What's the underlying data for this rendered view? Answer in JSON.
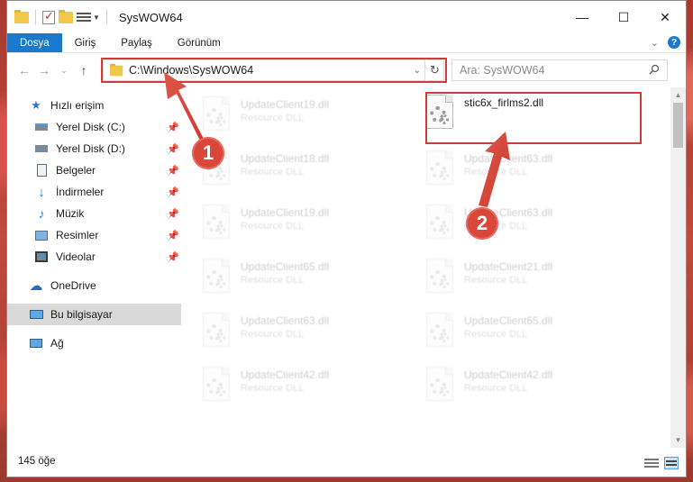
{
  "window": {
    "title": "SysWOW64",
    "controls": {
      "minimize": "—",
      "maximize": "☐",
      "close": "✕"
    }
  },
  "ribbon": {
    "tabs": [
      "Dosya",
      "Giriş",
      "Paylaş",
      "Görünüm"
    ]
  },
  "address": {
    "path": "C:\\Windows\\SysWOW64",
    "search_placeholder": "Ara: SysWOW64"
  },
  "sidebar": {
    "items": [
      {
        "label": "Hızlı erişim",
        "icon": "star-icon"
      },
      {
        "label": "Yerel Disk (C:)",
        "icon": "drive-icon",
        "pinned": true
      },
      {
        "label": "Yerel Disk (D:)",
        "icon": "drive-icon",
        "pinned": true
      },
      {
        "label": "Belgeler",
        "icon": "documents-icon",
        "pinned": true
      },
      {
        "label": "İndirmeler",
        "icon": "download-icon",
        "pinned": true
      },
      {
        "label": "Müzik",
        "icon": "music-icon",
        "pinned": true
      },
      {
        "label": "Resimler",
        "icon": "pictures-icon",
        "pinned": true
      },
      {
        "label": "Videolar",
        "icon": "videos-icon",
        "pinned": true
      },
      {
        "label": "OneDrive",
        "icon": "cloud-icon"
      },
      {
        "label": "Bu bilgisayar",
        "icon": "computer-icon",
        "selected": true
      },
      {
        "label": "Ağ",
        "icon": "network-icon"
      }
    ]
  },
  "files": {
    "highlighted": {
      "name": "stic6x_firlms2.dll",
      "type": ""
    },
    "left_column": [
      {
        "name": "UpdateClient19.dll",
        "type": "Resource DLL"
      },
      {
        "name": "UpdateClient18.dll",
        "type": "Resource DLL"
      },
      {
        "name": "UpdateClient19.dll",
        "type": "Resource DLL"
      },
      {
        "name": "UpdateClient65.dll",
        "type": "Resource DLL"
      },
      {
        "name": "UpdateClient63.dll",
        "type": "Resource DLL"
      },
      {
        "name": "UpdateClient42.dll",
        "type": "Resource DLL"
      }
    ],
    "right_column": [
      {
        "name": "UpdateClient63.dll",
        "type": "Resource DLL"
      },
      {
        "name": "UpdateClient63.dll",
        "type": "Resource DLL"
      },
      {
        "name": "UpdateClient21.dll",
        "type": "Resource DLL"
      },
      {
        "name": "UpdateClient65.dll",
        "type": "Resource DLL"
      },
      {
        "name": "UpdateClient42.dll",
        "type": "Resource DLL"
      }
    ]
  },
  "status": {
    "item_count": "145 öğe"
  },
  "annotations": {
    "badge1": "1",
    "badge2": "2",
    "color": "#d9473a"
  }
}
